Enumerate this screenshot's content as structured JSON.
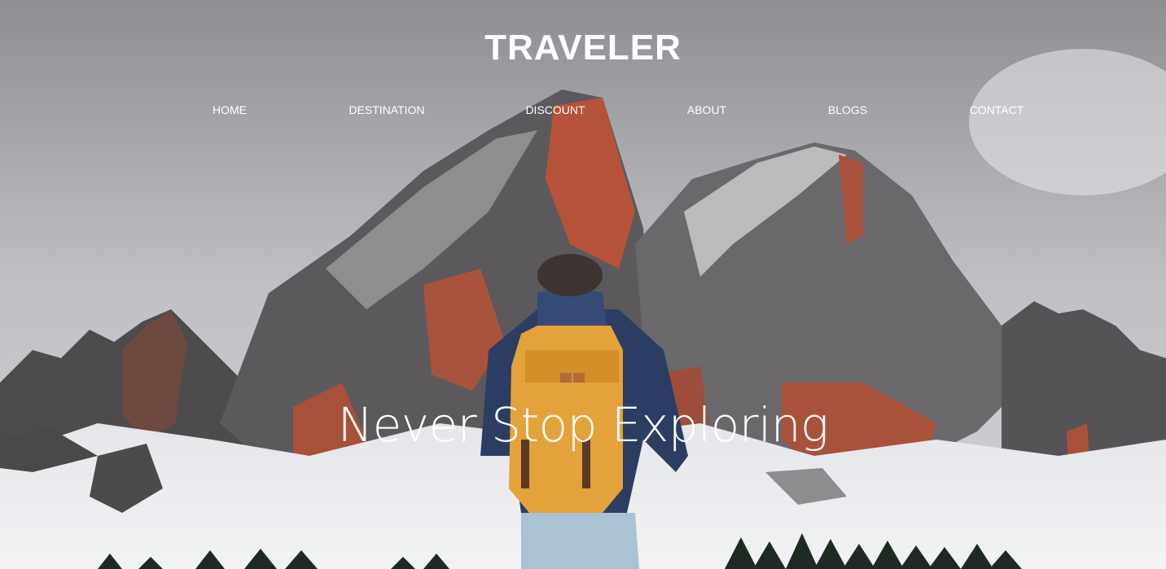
{
  "header": {
    "brand": "TRAVELER"
  },
  "nav": {
    "items": [
      {
        "label": "HOME"
      },
      {
        "label": "DESTINATION"
      },
      {
        "label": "DISCOUNT"
      },
      {
        "label": "ABOUT"
      },
      {
        "label": "BLOGS"
      },
      {
        "label": "CONTACT"
      }
    ]
  },
  "hero": {
    "tagline": "Never Stop Exploring",
    "image": "snowy-mountains-hiker-backpack"
  },
  "colors": {
    "text": "#ffffff",
    "rock": "#b5533a",
    "backpack": "#e3a23a",
    "jacket": "#2c3d63"
  }
}
